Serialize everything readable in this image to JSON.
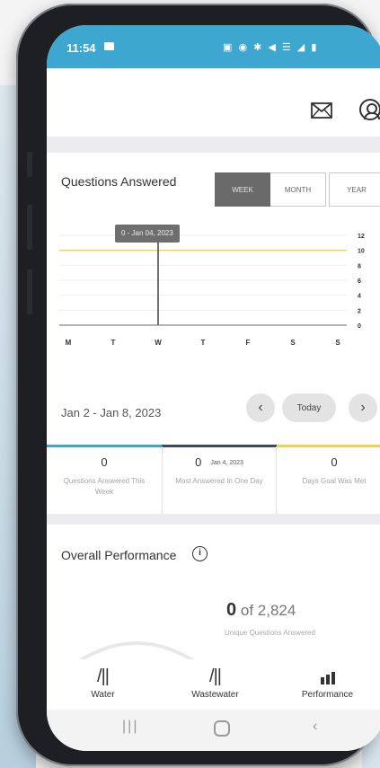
{
  "status_bar": {
    "time": "11:54",
    "icons": "▣ ◉ ✱ ◀ ☰ ◢ ▮"
  },
  "chart_tabs": {
    "week": "WEEK",
    "month": "MONTH",
    "year": "YEAR",
    "active": "WEEK"
  },
  "card": {
    "title": "Questions Answered"
  },
  "chart_data": {
    "type": "bar",
    "categories": [
      "M",
      "T",
      "W",
      "T",
      "F",
      "S",
      "S"
    ],
    "values": [
      0,
      0,
      0,
      0,
      0,
      0,
      0
    ],
    "highlight_index": 2,
    "goal_line": 10,
    "goal_color": "#f0d14e",
    "yticks": [
      "12",
      "10",
      "8",
      "6",
      "4",
      "2",
      "0"
    ],
    "ylim": [
      0,
      12
    ],
    "tooltip": "0 - Jan 04, 2023"
  },
  "date_nav": {
    "range": "Jan 2 - Jan 8, 2023",
    "today": "Today",
    "prev": "‹",
    "next": "›"
  },
  "stats": [
    {
      "value": "0",
      "label": "Questions Answered This Week",
      "color": "#3da7cf"
    },
    {
      "value": "0",
      "date": "Jan 4, 2023",
      "label": "Most Answered In One Day",
      "color": "#3a4a63"
    },
    {
      "value": "0",
      "label": "Days Goal Was Met",
      "color": "#f0d14e"
    }
  ],
  "performance": {
    "title": "Overall Performance",
    "info": "i",
    "count": "0",
    "of_text": "of 2,824",
    "subtitle": "Unique Questions Answered"
  },
  "bottom_nav": [
    {
      "label": "Water",
      "icon": "/||"
    },
    {
      "label": "Wastewater",
      "icon": "/||"
    },
    {
      "label": "Performance",
      "icon": "bar-chart-icon"
    }
  ],
  "colors": {
    "accent": "#3da7cf",
    "navy": "#3a4a63",
    "goal": "#f0d14e"
  }
}
